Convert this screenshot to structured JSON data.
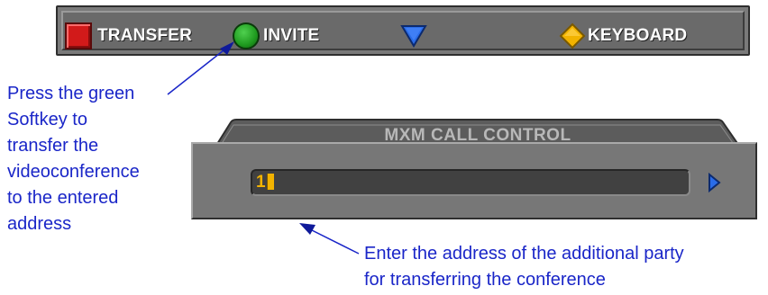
{
  "softkeys": {
    "red": {
      "label": "TRANSFER",
      "icon": "red-square-icon",
      "color": "#d21a1a"
    },
    "green": {
      "label": "INVITE",
      "icon": "green-circle-icon",
      "color": "#1f9a1f"
    },
    "blue": {
      "label": "",
      "icon": "blue-triangle-icon",
      "color": "#2a6ce8"
    },
    "yellow": {
      "label": "KEYBOARD",
      "icon": "yellow-diamond-icon",
      "color": "#f2b300"
    }
  },
  "call_control": {
    "title": "MXM CALL CONTROL",
    "address_value": "1",
    "scroll_icon": "blue-arrow-right-icon"
  },
  "callouts": {
    "green_softkey": [
      "Press the green",
      "Softkey to",
      "transfer the",
      "videoconference",
      "to the entered",
      "address"
    ],
    "address_field": [
      "Enter the address of the additional party",
      "for transferring the conference"
    ]
  },
  "colors": {
    "callout_text": "#1a26c8",
    "panel": "#777777",
    "field_text": "#f2b300"
  }
}
